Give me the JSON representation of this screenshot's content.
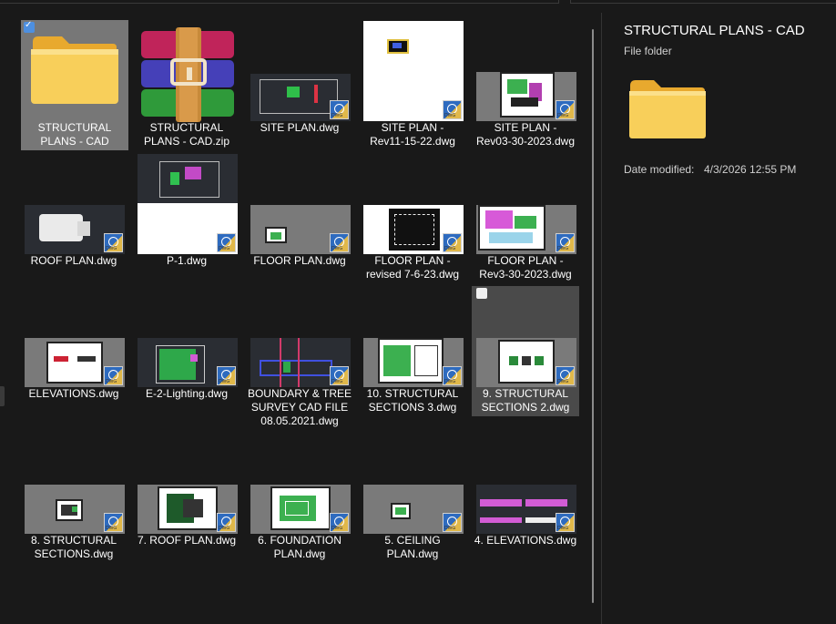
{
  "items": [
    {
      "name": "STRUCTURAL\nPLANS - CAD",
      "kind": "folder"
    },
    {
      "name": "STRUCTURAL\nPLANS - CAD.zip",
      "kind": "zip"
    },
    {
      "name": "SITE PLAN.dwg",
      "kind": "dwg"
    },
    {
      "name": "SITE PLAN -\nRev11-15-22.dwg",
      "kind": "dwg"
    },
    {
      "name": "SITE PLAN -\nRev03-30-2023.dwg",
      "kind": "dwg"
    },
    {
      "name": "ROOF PLAN.dwg",
      "kind": "dwg"
    },
    {
      "name": "P-1.dwg",
      "kind": "dwg"
    },
    {
      "name": "FLOOR PLAN.dwg",
      "kind": "dwg"
    },
    {
      "name": "FLOOR PLAN -\nrevised 7-6-23.dwg",
      "kind": "dwg"
    },
    {
      "name": "FLOOR PLAN -\nRev3-30-2023.dwg",
      "kind": "dwg"
    },
    {
      "name": "ELEVATIONS.dwg",
      "kind": "dwg"
    },
    {
      "name": "E-2-Lighting.dwg",
      "kind": "dwg"
    },
    {
      "name": "BOUNDARY & TREE\nSURVEY CAD FILE\n08.05.2021.dwg",
      "kind": "dwg"
    },
    {
      "name": "10. STRUCTURAL\nSECTIONS 3.dwg",
      "kind": "dwg"
    },
    {
      "name": "9. STRUCTURAL\nSECTIONS 2.dwg",
      "kind": "dwg"
    },
    {
      "name": "8. STRUCTURAL\nSECTIONS.dwg",
      "kind": "dwg"
    },
    {
      "name": "7. ROOF PLAN.dwg",
      "kind": "dwg"
    },
    {
      "name": "6. FOUNDATION\nPLAN.dwg",
      "kind": "dwg"
    },
    {
      "name": "5. CEILING\nPLAN.dwg",
      "kind": "dwg"
    },
    {
      "name": "4. ELEVATIONS.dwg",
      "kind": "dwg"
    }
  ],
  "selected_item": "STRUCTURAL PLANS - CAD",
  "hovered_item": "9. STRUCTURAL SECTIONS 2.dwg",
  "details": {
    "title": "STRUCTURAL PLANS - CAD",
    "type": "File folder",
    "date_modified_label": "Date modified:",
    "date_modified_value": "4/3/2026 12:55 PM"
  },
  "colors": {
    "background": "#191919",
    "selection": "#777777",
    "hover": "#4a4a4a",
    "folder": "#f5c94c",
    "checkbox_accent": "#4d8fe0"
  },
  "icons": [
    "folder-icon",
    "winrar-archive-icon",
    "dwg-badge-icon",
    "checkbox-icon"
  ]
}
